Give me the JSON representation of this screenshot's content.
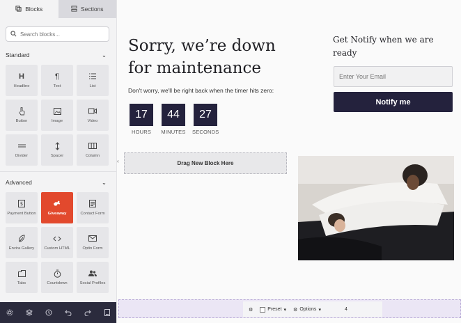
{
  "sidebar": {
    "tabs": [
      {
        "label": "Blocks",
        "icon": "blocks-icon",
        "active": true
      },
      {
        "label": "Sections",
        "icon": "sections-icon",
        "active": false
      }
    ],
    "search_placeholder": "Search blocks...",
    "standard": {
      "title": "Standard",
      "blocks": [
        {
          "label": "Headline",
          "icon": "headline-icon"
        },
        {
          "label": "Text",
          "icon": "paragraph-icon"
        },
        {
          "label": "List",
          "icon": "list-icon"
        },
        {
          "label": "Button",
          "icon": "pointer-icon"
        },
        {
          "label": "Image",
          "icon": "image-icon"
        },
        {
          "label": "Video",
          "icon": "video-icon"
        },
        {
          "label": "Divider",
          "icon": "divider-icon"
        },
        {
          "label": "Spacer",
          "icon": "spacer-icon"
        },
        {
          "label": "Column",
          "icon": "column-icon"
        }
      ]
    },
    "advanced": {
      "title": "Advanced",
      "blocks": [
        {
          "label": "Payment Button",
          "icon": "payment-icon"
        },
        {
          "label": "Giveaway",
          "icon": "giveaway-icon",
          "highlight_color": "#e2492d"
        },
        {
          "label": "Contact Form",
          "icon": "form-icon"
        },
        {
          "label": "Envira Gallery",
          "icon": "leaf-icon"
        },
        {
          "label": "Custom HTML",
          "icon": "code-icon"
        },
        {
          "label": "Optin Form",
          "icon": "mail-icon"
        },
        {
          "label": "Tabs",
          "icon": "tabs-icon"
        },
        {
          "label": "Countdown",
          "icon": "stopwatch-icon"
        },
        {
          "label": "Social Profiles",
          "icon": "people-icon"
        }
      ]
    },
    "bottom_icons": [
      "settings-icon",
      "layers-icon",
      "history-icon",
      "undo-icon",
      "redo-icon",
      "preview-icon"
    ]
  },
  "page": {
    "title": "Sorry, we’re down for maintenance",
    "subtitle": "Don't worry, we'll be right back when the timer hits zero:",
    "timer": [
      {
        "value": "17",
        "label": "HOURS"
      },
      {
        "value": "44",
        "label": "MINUTES"
      },
      {
        "value": "27",
        "label": "SECONDS"
      }
    ],
    "notify_title": "Get Notify when we are ready",
    "email_placeholder": "Enter Your Email",
    "notify_button": "Notify me",
    "dropzone": "Drag New Block Here"
  },
  "options_bar": {
    "preset": "Preset",
    "options": "Options",
    "count": "4"
  },
  "colors": {
    "accent": "#e2492d",
    "dark": "#24223d",
    "sidebar_bg": "#f3f3f4",
    "bottombar": "#2b2b3d"
  }
}
